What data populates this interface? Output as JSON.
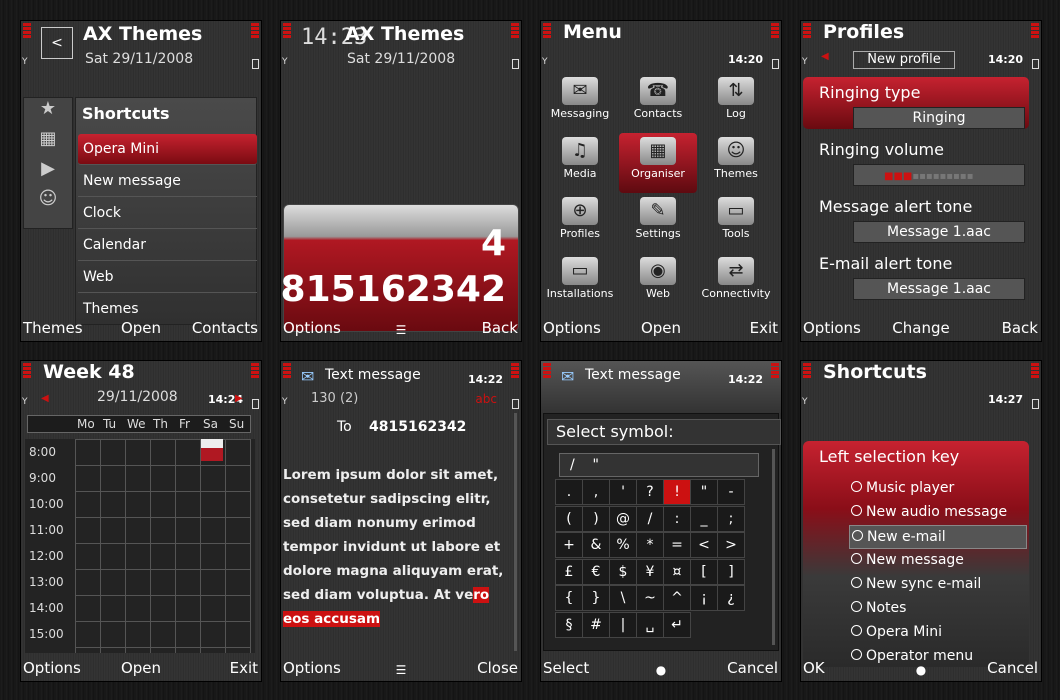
{
  "screens": [
    {
      "title": "AX Themes",
      "date": "Sat 29/11/2008",
      "panel_title": "Shortcuts",
      "items": [
        "Opera Mini",
        "New message",
        "Clock",
        "Calendar",
        "Web",
        "Themes"
      ],
      "soft": {
        "left": "Themes",
        "middle": "Open",
        "right": "Contacts"
      }
    },
    {
      "title": "AX Themes",
      "clock": "14:23",
      "date": "Sat 29/11/2008",
      "count": "4",
      "number": "815162342",
      "soft": {
        "left": "Options",
        "right": "Back"
      }
    },
    {
      "title": "Menu",
      "clock": "14:20",
      "items": [
        "Messaging",
        "Contacts",
        "Log",
        "Media",
        "Organiser",
        "Themes",
        "Profiles",
        "Settings",
        "Tools",
        "Installations",
        "Web",
        "Connectivity"
      ],
      "soft": {
        "left": "Options",
        "middle": "Open",
        "right": "Exit"
      }
    },
    {
      "title": "Profiles",
      "clock": "14:20",
      "subtitle": "New profile",
      "rows": [
        {
          "label": "Ringing type",
          "value": "Ringing"
        },
        {
          "label": "Ringing volume",
          "value": ""
        },
        {
          "label": "Message alert tone",
          "value": "Message 1.aac"
        },
        {
          "label": "E-mail alert tone",
          "value": "Message 1.aac"
        }
      ],
      "soft": {
        "left": "Options",
        "middle": "Change",
        "right": "Back"
      }
    },
    {
      "title": "Week 48",
      "clock": "14:24",
      "date": "29/11/2008",
      "days": [
        "Mo",
        "Tu",
        "We",
        "Th",
        "Fr",
        "Sa",
        "Su"
      ],
      "hours": [
        "8:00",
        "9:00",
        "10:00",
        "11:00",
        "12:00",
        "13:00",
        "14:00",
        "15:00"
      ],
      "soft": {
        "left": "Options",
        "middle": "Open",
        "right": "Exit"
      }
    },
    {
      "title": "Text message",
      "clock": "14:22",
      "counter": "130 (2)",
      "mode": "abc",
      "to_label": "To",
      "to_value": "4815162342",
      "body": "Lorem ipsum dolor sit amet, consetetur sadipscing elitr, sed diam nonumy erimod tempor invidunt ut labore et dolore magna aliquyam erat, sed diam voluptua. At ve",
      "body_hl": "ro eos accusam",
      "soft": {
        "left": "Options",
        "right": "Close"
      }
    },
    {
      "title": "Text message",
      "clock": "14:22",
      "panel_title": "Select symbol:",
      "symbols": [
        ".",
        ",",
        "'",
        "?",
        "!",
        "\"",
        "-",
        "(",
        ")",
        "@",
        "/",
        ":",
        "_",
        ";",
        "+",
        "&",
        "%",
        "*",
        "=",
        "<",
        ">",
        "£",
        "€",
        "$",
        "¥",
        "¤",
        "[",
        "]",
        "{",
        "}",
        "\\",
        "~",
        "^",
        "¡",
        "¿",
        "§",
        "#",
        "|",
        "␣",
        "↵"
      ],
      "soft": {
        "left": "Select",
        "right": "Cancel"
      }
    },
    {
      "title": "Shortcuts",
      "clock": "14:27",
      "panel_title": "Left selection key",
      "options": [
        "Music player",
        "New audio message",
        "New e-mail",
        "New message",
        "New sync e-mail",
        "Notes",
        "Opera Mini",
        "Operator menu"
      ],
      "soft": {
        "left": "OK",
        "right": "Cancel"
      }
    }
  ]
}
